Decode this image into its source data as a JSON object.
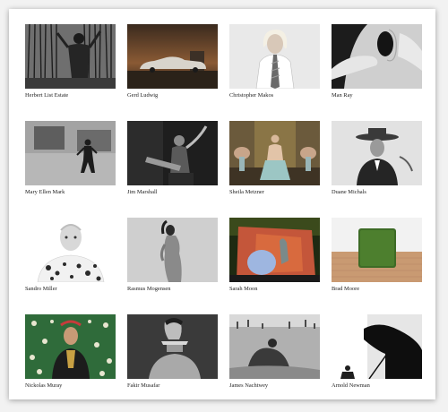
{
  "gallery": {
    "photographers": [
      {
        "name": "Herbert List Estate"
      },
      {
        "name": "Gerd Ludwig"
      },
      {
        "name": "Christopher Makos"
      },
      {
        "name": "Man Ray"
      },
      {
        "name": "Mary Ellen Mark"
      },
      {
        "name": "Jim Marshall"
      },
      {
        "name": "Sheila Metzner"
      },
      {
        "name": "Duane Michals"
      },
      {
        "name": "Sandro Miller"
      },
      {
        "name": "Rasmus Mogensen"
      },
      {
        "name": "Sarah Moon"
      },
      {
        "name": "Brad Moore"
      },
      {
        "name": "Nickolas Muray"
      },
      {
        "name": "Fakir Musafar"
      },
      {
        "name": "James Nachtwey"
      },
      {
        "name": "Arnold Newman"
      }
    ]
  },
  "colors": {
    "page_background": "#f2f2f2",
    "frame_background": "#ffffff",
    "caption_text": "#222222"
  }
}
